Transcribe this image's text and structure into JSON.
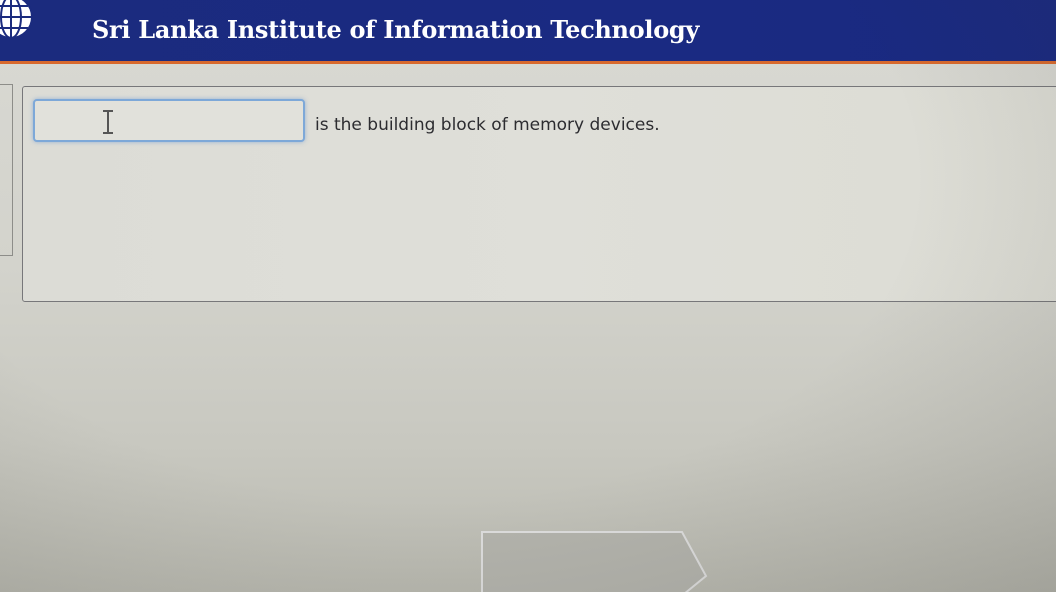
{
  "header": {
    "title": "Sri Lanka Institute of Information Technology",
    "logo_icon": "globe-logo-icon",
    "background_color": "#1b2b7e",
    "accent_color": "#d8692d"
  },
  "question": {
    "answer_value": "",
    "text": "is the building block of memory devices."
  },
  "icons": {
    "text_cursor": "text-cursor-icon"
  }
}
